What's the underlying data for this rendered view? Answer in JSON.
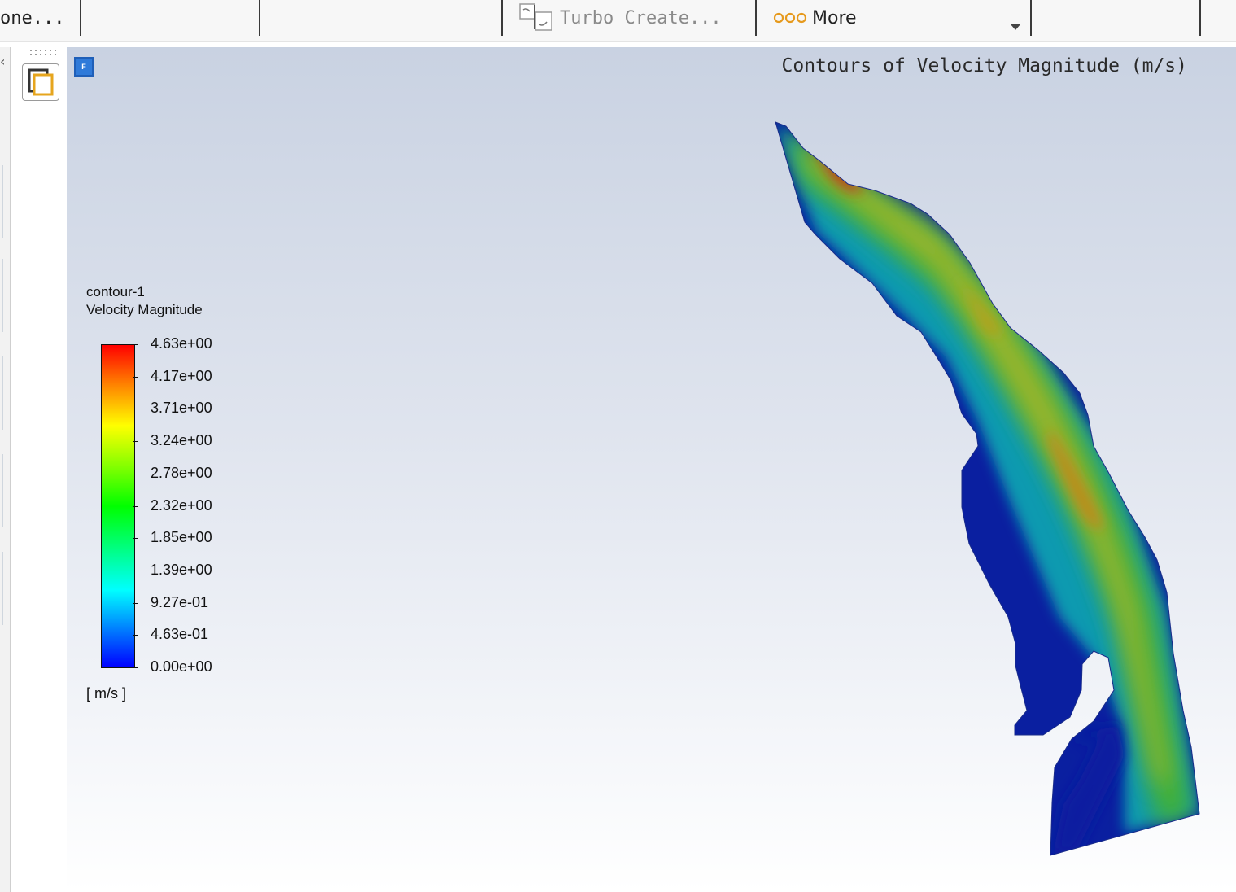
{
  "toolbar": {
    "items": [
      {
        "label": "one...",
        "enabled": true
      },
      {
        "label": "Turbo Create...",
        "enabled": false,
        "icon": "turbo-create-icon"
      },
      {
        "label": "More",
        "enabled": true,
        "icon": "more-dots-icon"
      }
    ]
  },
  "graphics": {
    "title": "Contours of Velocity Magnitude (m/s)",
    "logo": "ansys-fluent-logo"
  },
  "legend": {
    "name": "contour-1",
    "variable": "Velocity Magnitude",
    "units": "[ m/s ]",
    "ticks": [
      "4.63e+00",
      "4.17e+00",
      "3.71e+00",
      "3.24e+00",
      "2.78e+00",
      "2.32e+00",
      "1.85e+00",
      "1.39e+00",
      "9.27e-01",
      "4.63e-01",
      "0.00e+00"
    ],
    "colormap": [
      "#0000ff",
      "#0080ff",
      "#00ffff",
      "#00ff80",
      "#00ff00",
      "#80ff00",
      "#ffff00",
      "#ff8000",
      "#ff0000"
    ],
    "min": 0,
    "max": 4.63
  },
  "colors": {
    "accent": "#2f7ad9",
    "more_icon": "#e69a1e"
  }
}
